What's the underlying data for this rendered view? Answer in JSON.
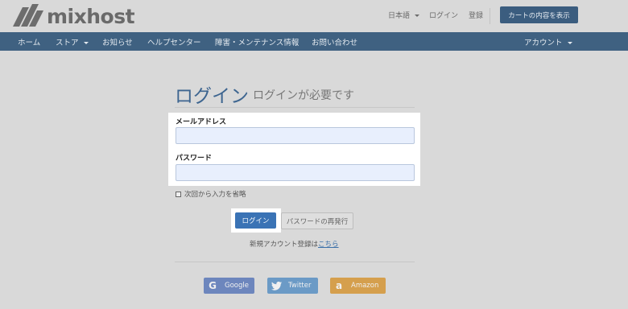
{
  "header": {
    "logo_text": "mixhost",
    "language": "日本語",
    "login_link": "ログイン",
    "register_link": "登録",
    "cart_button": "カートの内容を表示"
  },
  "nav": {
    "items": [
      {
        "label": "ホーム"
      },
      {
        "label": "ストア"
      },
      {
        "label": "お知らせ"
      },
      {
        "label": "ヘルプセンター"
      },
      {
        "label": "障害・メンテナンス情報"
      },
      {
        "label": "お問い合わせ"
      }
    ],
    "account": "アカウント"
  },
  "main": {
    "title": "ログイン",
    "subtitle": "ログインが必要です",
    "email_label": "メールアドレス",
    "email_value": "",
    "password_label": "パスワード",
    "password_value": "",
    "remember_label": "次回から入力を省略",
    "login_button": "ログイン",
    "reset_button": "パスワードの再発行",
    "signup_text": "新規アカウント登録は",
    "signup_link": "こちら"
  },
  "social": {
    "google": {
      "icon": "G",
      "label": "Google"
    },
    "twitter": {
      "label": "Twitter"
    },
    "amazon": {
      "icon": "a",
      "label": "Amazon"
    }
  },
  "colors": {
    "navbar": "#3f6181",
    "cart_button": "#3b5d7f",
    "login_button": "#3a73b5",
    "google": "#6d86bd",
    "twitter": "#6b9ac6",
    "amazon": "#d59f4d"
  }
}
